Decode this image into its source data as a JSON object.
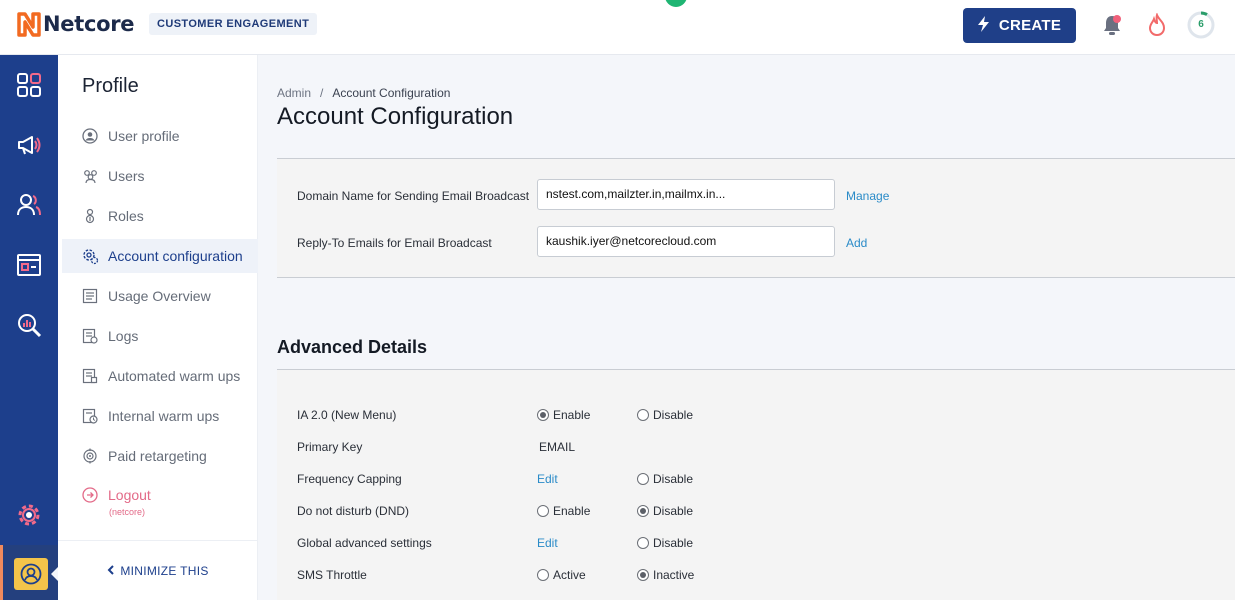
{
  "header": {
    "logo_text": "Netcore",
    "product_tag": "CUSTOMER ENGAGEMENT",
    "create_label": "CREATE",
    "progress_value": "6"
  },
  "colors": {
    "rail": "#1d3f8c",
    "create_button": "#1f3f88",
    "link": "#2a8bc8",
    "logout": "#e36a88",
    "avatar_bg": "#f4c44a"
  },
  "rail": {
    "items": [
      {
        "icon": "dashboard-grid-icon"
      },
      {
        "icon": "megaphone-icon"
      },
      {
        "icon": "users-icon"
      },
      {
        "icon": "layout-card-icon"
      },
      {
        "icon": "search-analytics-icon"
      },
      {
        "icon": "settings-gear-icon"
      }
    ],
    "avatar_icon": "user-avatar-icon"
  },
  "sidebar": {
    "title": "Profile",
    "items": [
      {
        "label": "User profile",
        "icon": "user-circle-icon"
      },
      {
        "label": "Users",
        "icon": "users-group-icon"
      },
      {
        "label": "Roles",
        "icon": "role-icon"
      },
      {
        "label": "Account configuration",
        "icon": "config-gear-icon"
      },
      {
        "label": "Usage Overview",
        "icon": "usage-doc-icon"
      },
      {
        "label": "Logs",
        "icon": "logs-icon"
      },
      {
        "label": "Automated warm ups",
        "icon": "automated-doc-icon"
      },
      {
        "label": "Internal warm ups",
        "icon": "internal-doc-icon"
      },
      {
        "label": "Paid retargeting",
        "icon": "target-icon"
      },
      {
        "label": "Logout",
        "icon": "logout-icon"
      }
    ],
    "logout_sub": "(netcore)",
    "minimize_label": "MINIMIZE THIS"
  },
  "breadcrumb": {
    "root": "Admin",
    "separator": "/",
    "current": "Account Configuration"
  },
  "page_title": "Account Configuration",
  "email_settings": {
    "domain_label": "Domain Name for Sending Email Broadcast",
    "domain_value": "nstest.com,mailzter.in,mailmx.in...",
    "domain_link": "Manage",
    "replyto_label": "Reply-To Emails for Email Broadcast",
    "replyto_value": "kaushik.iyer@netcorecloud.com",
    "replyto_link": "Add"
  },
  "advanced": {
    "title": "Advanced Details",
    "rows": [
      {
        "label": "IA 2.0 (New Menu)",
        "opt1": "Enable",
        "opt1_selected": true,
        "opt2": "Disable",
        "opt2_selected": false
      },
      {
        "label": "Primary Key",
        "value": "EMAIL"
      },
      {
        "label": "Frequency Capping",
        "edit": "Edit",
        "opt2": "Disable",
        "opt2_selected": false
      },
      {
        "label": "Do not disturb (DND)",
        "opt1": "Enable",
        "opt1_selected": false,
        "opt2": "Disable",
        "opt2_selected": true
      },
      {
        "label": "Global advanced settings",
        "edit": "Edit",
        "opt2": "Disable",
        "opt2_selected": false
      },
      {
        "label": "SMS Throttle",
        "opt1": "Active",
        "opt1_selected": false,
        "opt2": "Inactive",
        "opt2_selected": true
      }
    ]
  }
}
